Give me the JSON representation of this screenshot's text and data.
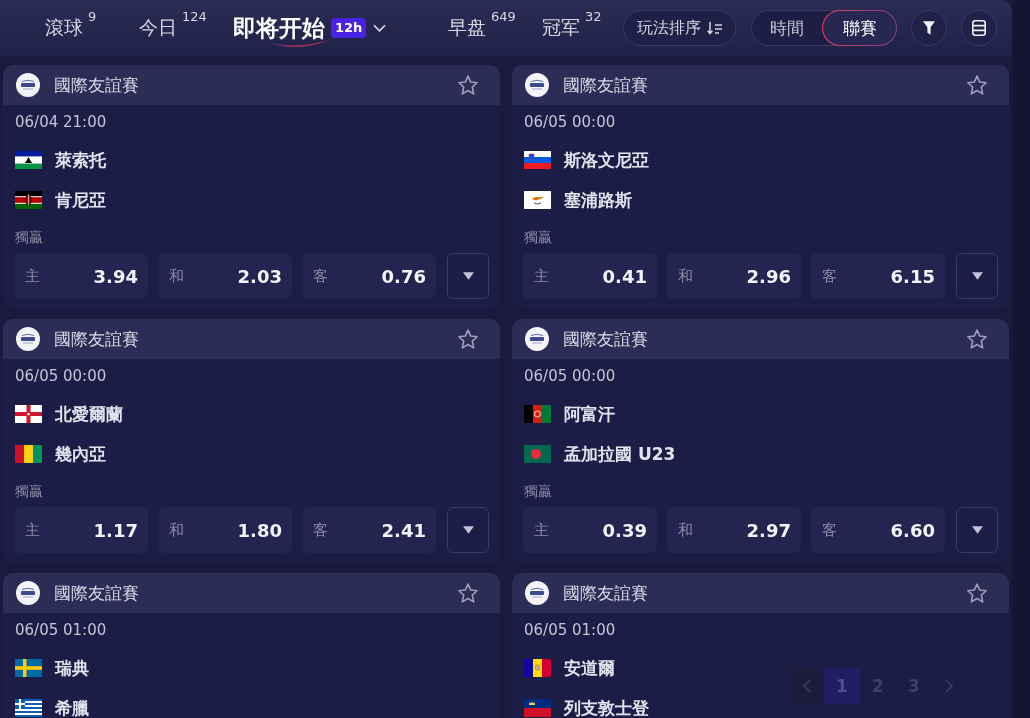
{
  "top_bar": {
    "tabs": [
      {
        "label": "滾球",
        "count": "9",
        "selected": false
      },
      {
        "label": "今日",
        "count": "124",
        "selected": false
      },
      {
        "label": "即将开始",
        "badge": "12h",
        "selected": true
      },
      {
        "label": "早盘",
        "count": "649",
        "selected": false
      },
      {
        "label": "冠军",
        "count": "32",
        "selected": false
      }
    ],
    "sort_button": {
      "label": "玩法排序"
    },
    "view_toggle": [
      {
        "label": "時間",
        "selected": false
      },
      {
        "label": "聯賽",
        "selected": true
      }
    ]
  },
  "matches": [
    {
      "league": "國際友誼賽",
      "favorited": false,
      "time": "06/04 21:00",
      "teams": [
        {
          "name": "萊索托",
          "kind": "lesotho"
        },
        {
          "name": "肯尼亞",
          "kind": "kenya"
        }
      ],
      "market": {
        "title": "獨贏",
        "odds": [
          {
            "label": "主",
            "value": "3.94"
          },
          {
            "label": "和",
            "value": "2.03"
          },
          {
            "label": "客",
            "value": "0.76"
          }
        ]
      }
    },
    {
      "league": "國際友誼賽",
      "favorited": false,
      "time": "06/05 00:00",
      "teams": [
        {
          "name": "斯洛文尼亞",
          "kind": "slovenia"
        },
        {
          "name": "塞浦路斯",
          "kind": "cyprus"
        }
      ],
      "market": {
        "title": "獨贏",
        "odds": [
          {
            "label": "主",
            "value": "0.41"
          },
          {
            "label": "和",
            "value": "2.96"
          },
          {
            "label": "客",
            "value": "6.15"
          }
        ]
      }
    },
    {
      "league": "國際友誼賽",
      "favorited": false,
      "time": "06/05 00:00",
      "teams": [
        {
          "name": "北愛爾蘭",
          "kind": "northernireland"
        },
        {
          "name": "幾內亞",
          "kind": "guinea"
        }
      ],
      "market": {
        "title": "獨贏",
        "odds": [
          {
            "label": "主",
            "value": "1.17"
          },
          {
            "label": "和",
            "value": "1.80"
          },
          {
            "label": "客",
            "value": "2.41"
          }
        ]
      }
    },
    {
      "league": "國際友誼賽",
      "favorited": false,
      "time": "06/05 00:00",
      "teams": [
        {
          "name": "阿富汗",
          "kind": "afghanistan"
        },
        {
          "name": "孟加拉國 U23",
          "kind": "bangladesh"
        }
      ],
      "market": {
        "title": "獨贏",
        "odds": [
          {
            "label": "主",
            "value": "0.39"
          },
          {
            "label": "和",
            "value": "2.97"
          },
          {
            "label": "客",
            "value": "6.60"
          }
        ]
      }
    },
    {
      "league": "國際友誼賽",
      "favorited": false,
      "time": "06/05 01:00",
      "teams": [
        {
          "name": "瑞典",
          "kind": "sweden"
        },
        {
          "name": "希臘",
          "kind": "greece"
        }
      ]
    },
    {
      "league": "國際友誼賽",
      "favorited": false,
      "time": "06/05 01:00",
      "teams": [
        {
          "name": "安道爾",
          "kind": "andorra"
        },
        {
          "name": "列支敦士登",
          "kind": "liechtenstein"
        }
      ]
    }
  ],
  "pagination": {
    "pages": [
      {
        "label": "1",
        "selected": true
      },
      {
        "label": "2",
        "selected": false
      },
      {
        "label": "3",
        "selected": false
      }
    ]
  }
}
